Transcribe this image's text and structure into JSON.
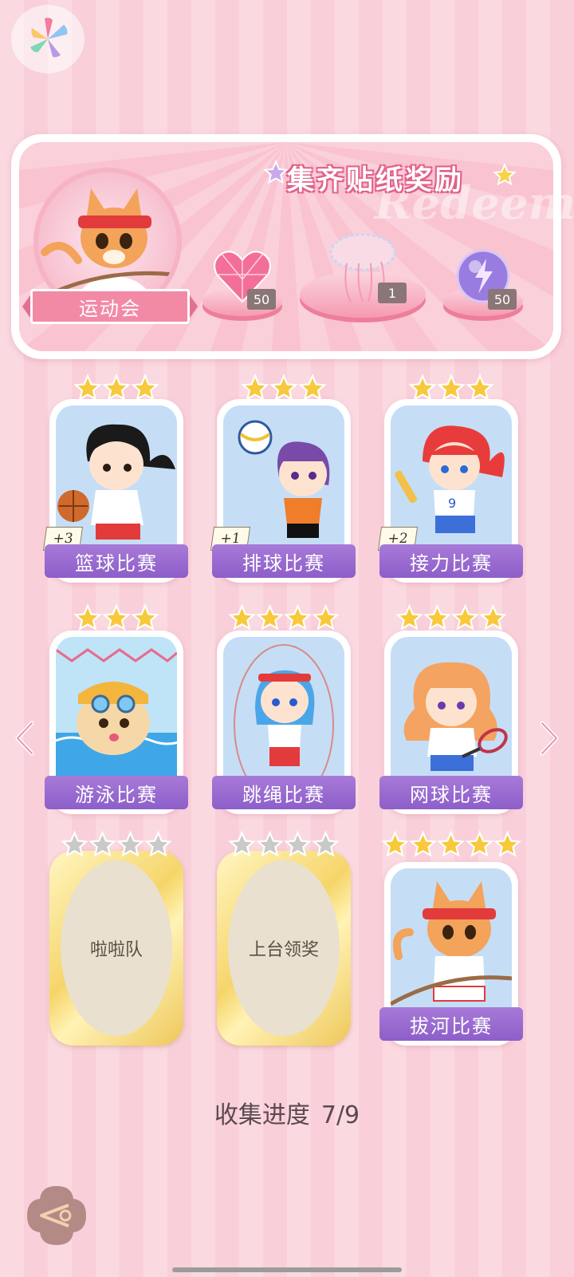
{
  "banner": {
    "title": "集齐贴纸奖励",
    "watermark": "Redeem",
    "event_name": "运动会",
    "rewards": [
      {
        "icon": "pink-heart-gem-icon",
        "count": "50"
      },
      {
        "icon": "jellyfish-decoration-icon",
        "count": "1"
      },
      {
        "icon": "purple-lightning-orb-icon",
        "count": "50"
      }
    ]
  },
  "stickers": [
    {
      "name": "篮球比赛",
      "stars": 3,
      "max_stars": 3,
      "bonus": "+3",
      "unlocked": true,
      "art": "girl-basketball"
    },
    {
      "name": "排球比赛",
      "stars": 3,
      "max_stars": 3,
      "bonus": "+1",
      "unlocked": true,
      "art": "girl-volleyball"
    },
    {
      "name": "接力比赛",
      "stars": 3,
      "max_stars": 3,
      "bonus": "+2",
      "unlocked": true,
      "art": "girl-relay"
    },
    {
      "name": "游泳比赛",
      "stars": 3,
      "max_stars": 3,
      "bonus": "",
      "unlocked": true,
      "art": "puppy-swimming"
    },
    {
      "name": "跳绳比赛",
      "stars": 4,
      "max_stars": 4,
      "bonus": "",
      "unlocked": true,
      "art": "girl-jumprope"
    },
    {
      "name": "网球比赛",
      "stars": 4,
      "max_stars": 4,
      "bonus": "",
      "unlocked": true,
      "art": "girl-tennis"
    },
    {
      "name": "啦啦队",
      "stars": 0,
      "max_stars": 4,
      "bonus": "",
      "unlocked": false
    },
    {
      "name": "上台领奖",
      "stars": 0,
      "max_stars": 4,
      "bonus": "",
      "unlocked": false
    },
    {
      "name": "拔河比赛",
      "stars": 5,
      "max_stars": 5,
      "bonus": "",
      "unlocked": true,
      "art": "cat-tug-of-war"
    }
  ],
  "progress": {
    "label": "收集进度",
    "value": "7/9"
  },
  "colors": {
    "accent_pink": "#f28aa6",
    "label_purple": "#9a6bd1",
    "star_gold": "#f7c93b",
    "star_gray": "#c9c9c9"
  }
}
